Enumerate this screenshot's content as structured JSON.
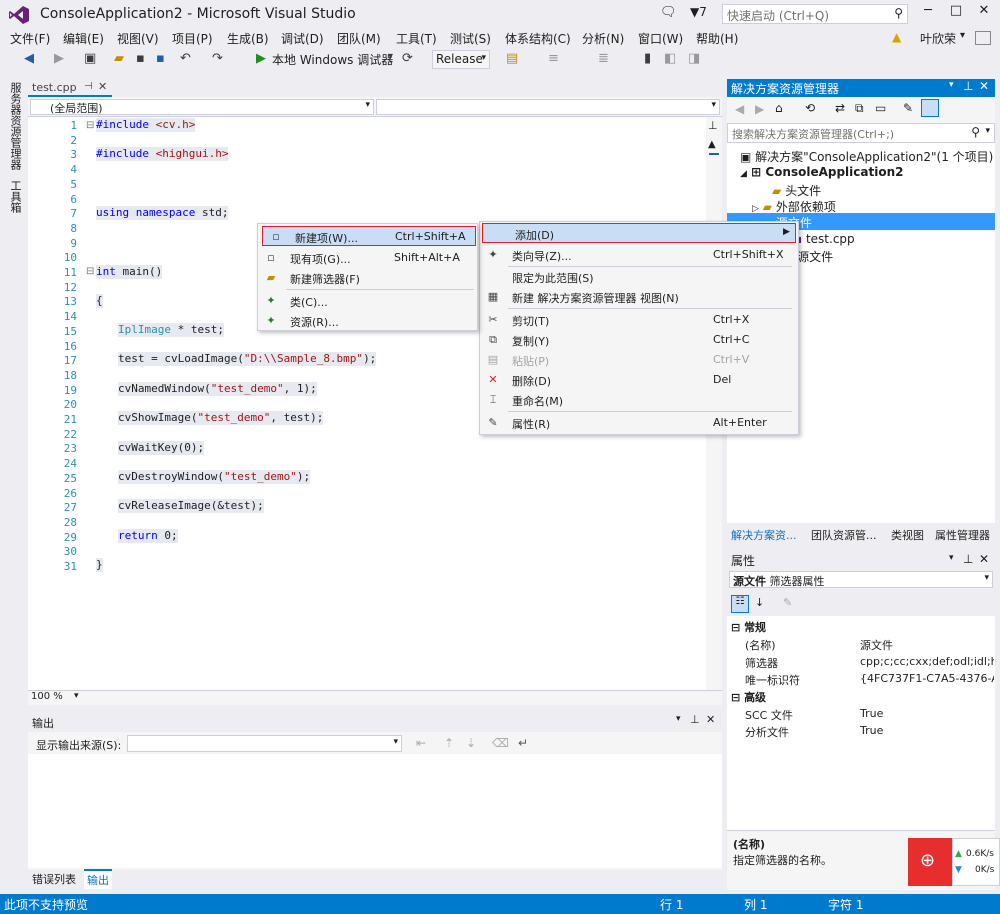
{
  "window": {
    "title": "ConsoleApplication2 - Microsoft Visual Studio",
    "filter_count": "7",
    "quick_launch_placeholder": "快速启动 (Ctrl+Q)",
    "user": "叶欣荣"
  },
  "menu": [
    "文件(F)",
    "编辑(E)",
    "视图(V)",
    "项目(P)",
    "生成(B)",
    "调试(D)",
    "团队(M)",
    "工具(T)",
    "测试(S)",
    "体系结构(C)",
    "分析(N)",
    "窗口(W)",
    "帮助(H)"
  ],
  "toolbar": {
    "debugger": "本地 Windows 调试器",
    "config": "Release"
  },
  "left_strip": {
    "server_explorer": "服务器资源管理器",
    "toolbox": "工具箱"
  },
  "editor": {
    "tab": "test.cpp",
    "scope": "(全局范围)",
    "zoom": "100 %",
    "lines": [
      "1",
      "2",
      "3",
      "4",
      "5",
      "6",
      "7",
      "8",
      "9",
      "10",
      "11",
      "12",
      "13",
      "14",
      "15",
      "16",
      "17",
      "18",
      "19",
      "20",
      "21",
      "22",
      "23",
      "24",
      "25",
      "26",
      "27",
      "28",
      "29",
      "30",
      "31"
    ],
    "code": {
      "l1a": "#include ",
      "l1b": "<cv.h>",
      "l3a": "#include ",
      "l3b": "<highgui.h>",
      "l7a": "using namespace ",
      "l7b": "std;",
      "l11a": "int ",
      "l11b": "main()",
      "l13": "{",
      "l15a": "IplImage",
      "l15b": " * test;",
      "l17a": "test = cvLoadImage(",
      "l17b": "\"D:\\\\Sample_8.bmp\"",
      "l17c": ");",
      "l19a": "cvNamedWindow(",
      "l19b": "\"test_demo\"",
      "l19c": ", 1);",
      "l21a": "cvShowImage(",
      "l21b": "\"test_demo\"",
      "l21c": ", test);",
      "l23": "cvWaitKey(0);",
      "l25a": "cvDestroyWindow(",
      "l25b": "\"test_demo\"",
      "l25c": ");",
      "l27": "cvReleaseImage(&test);",
      "l29a": "return ",
      "l29b": "0;",
      "l31": "}"
    }
  },
  "output": {
    "title": "输出",
    "source_label": "显示输出来源(S):"
  },
  "bottom_tabs": [
    "错误列表",
    "输出"
  ],
  "status": {
    "message": "此项不支持预览",
    "row": "行 1",
    "col": "列 1",
    "char": "字符 1"
  },
  "solution_explorer": {
    "title": "解决方案资源管理器",
    "search_placeholder": "搜索解决方案资源管理器(Ctrl+;)",
    "solution": "解决方案\"ConsoleApplication2\"(1 个项目)",
    "project": "ConsoleApplication2",
    "headers": "头文件",
    "external": "外部依赖项",
    "sources": "源文件",
    "file": "test.cpp",
    "resources": "资源文件"
  },
  "right_tabs": [
    "解决方案资...",
    "团队资源管...",
    "类视图",
    "属性管理器"
  ],
  "properties": {
    "title": "属性",
    "object": "源文件",
    "object_type": "筛选器属性",
    "cat_general": "常规",
    "cat_advanced": "高级",
    "rows": [
      {
        "name": "(名称)",
        "value": "源文件"
      },
      {
        "name": "筛选器",
        "value": "cpp;c;cc;cxx;def;odl;idl;hpj"
      },
      {
        "name": "唯一标识符",
        "value": "{4FC737F1-C7A5-4376-A0"
      }
    ],
    "adv_rows": [
      {
        "name": "SCC 文件",
        "value": "True"
      },
      {
        "name": "分析文件",
        "value": "True"
      }
    ],
    "desc_title": "(名称)",
    "desc_text": "指定筛选器的名称。"
  },
  "context_menu": {
    "add": "添加(D)",
    "class_wizard": "类向导(Z)...",
    "class_wizard_sc": "Ctrl+Shift+X",
    "scope": "限定为此范围(S)",
    "new_view": "新建 解决方案资源管理器 视图(N)",
    "cut": "剪切(T)",
    "cut_sc": "Ctrl+X",
    "copy": "复制(Y)",
    "copy_sc": "Ctrl+C",
    "paste": "粘贴(P)",
    "paste_sc": "Ctrl+V",
    "delete": "删除(D)",
    "delete_sc": "Del",
    "rename": "重命名(M)",
    "props": "属性(R)",
    "props_sc": "Alt+Enter"
  },
  "submenu": {
    "new_item": "新建项(W)...",
    "new_item_sc": "Ctrl+Shift+A",
    "existing": "现有项(G)...",
    "existing_sc": "Shift+Alt+A",
    "new_filter": "新建筛选器(F)",
    "class": "类(C)...",
    "resource": "资源(R)..."
  },
  "network": {
    "up": "0.6K/s",
    "down": "0K/s"
  },
  "colors": {
    "accent": "#007ACC",
    "selection": "#3399FF",
    "highlight_border": "#E0202B"
  }
}
